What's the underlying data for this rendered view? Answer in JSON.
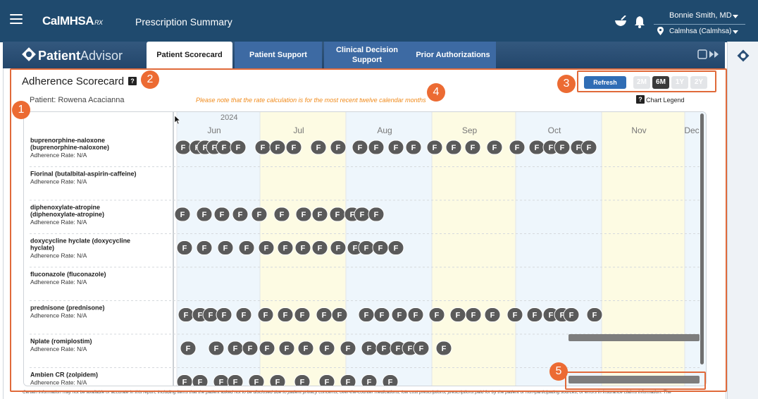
{
  "header": {
    "logo": "CalMHSA",
    "logo_suffix": "RX",
    "title": "Prescription Summary",
    "user_name": "Bonnie Smith, MD",
    "org_name": "Calmhsa (Calmhsa)"
  },
  "tabs": {
    "brand_bold": "Patient",
    "brand_thin": "Advisor",
    "items": [
      {
        "label": "Patient Scorecard"
      },
      {
        "label": "Patient Support"
      },
      {
        "label": "Clinical Decision Support"
      },
      {
        "label": "Prior Authorizations"
      }
    ]
  },
  "scorecard": {
    "title": "Adherence Scorecard",
    "help": "?",
    "patient": "Patient: Rowena Acacianna",
    "rate_note": "Please note that the rate calculation is for the most recent twelve calendar months",
    "refresh_label": "Refresh",
    "ranges": [
      "2M",
      "6M",
      "1Y",
      "2Y"
    ],
    "active_range": "6M",
    "legend_label": "Chart Legend",
    "disclaimer": "Certain information may not be available or accurate in this report, including items that the patient asked not to be disclosed due to patient privacy concerns, over-the-counter medications, low cost prescriptions, prescriptions paid for by the patient or non-participating sources, or errors in insurance claims information. The"
  },
  "callouts": [
    "1",
    "2",
    "3",
    "4",
    "5"
  ],
  "chart_data": {
    "type": "timeline",
    "year_label": "2024",
    "months": [
      "Jun",
      "Jul",
      "Aug",
      "Sep",
      "Oct",
      "Nov",
      "Dec"
    ],
    "fill_marker": "F",
    "medications": [
      {
        "name": "buprenorphine-naloxone (buprenorphine-naloxone)",
        "rate": "Adherence Rate: N/A"
      },
      {
        "name": "Fiorinal (butalbital-aspirin-caffeine)",
        "rate": "Adherence Rate: N/A"
      },
      {
        "name": "diphenoxylate-atropine (diphenoxylate-atropine)",
        "rate": "Adherence Rate: N/A"
      },
      {
        "name": "doxycycline hyclate (doxycycline hyclate)",
        "rate": "Adherence Rate: N/A"
      },
      {
        "name": "fluconazole (fluconazole)",
        "rate": "Adherence Rate: N/A"
      },
      {
        "name": "prednisone (prednisone)",
        "rate": "Adherence Rate: N/A"
      },
      {
        "name": "Nplate (romiplostim)",
        "rate": "Adherence Rate: N/A"
      },
      {
        "name": "Ambien CR (zolpidem)",
        "rate": "Adherence Rate: N/A"
      }
    ]
  }
}
